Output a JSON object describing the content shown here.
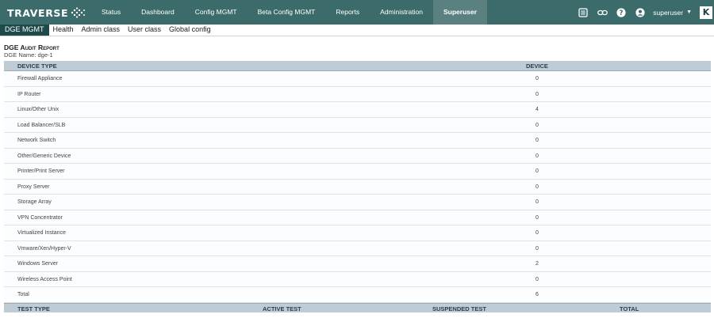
{
  "app": {
    "logo": "TRAVERSE"
  },
  "nav": {
    "items": [
      {
        "label": "Status"
      },
      {
        "label": "Dashboard"
      },
      {
        "label": "Config MGMT"
      },
      {
        "label": "Beta Config MGMT"
      },
      {
        "label": "Reports"
      },
      {
        "label": "Administration"
      },
      {
        "label": "Superuser",
        "active": true
      }
    ],
    "user": "superuser",
    "icons": [
      "list-icon",
      "link-icon",
      "help-icon",
      "user-icon",
      "brand-icon"
    ],
    "brand_letter": "K"
  },
  "subtabs": [
    {
      "label": "DGE MGMT",
      "active": true
    },
    {
      "label": "Health"
    },
    {
      "label": "Admin class"
    },
    {
      "label": "User class"
    },
    {
      "label": "Global config"
    }
  ],
  "report": {
    "title": "DGE Audit Report",
    "subtitle": "DGE Name: dge-1",
    "columns": [
      "DEVICE TYPE",
      "DEVICE"
    ],
    "rows": [
      {
        "type": "Firewall Appliance",
        "count": "0"
      },
      {
        "type": "IP Router",
        "count": "0"
      },
      {
        "type": "Linux/Other Unix",
        "count": "4"
      },
      {
        "type": "Load Balancer/SLB",
        "count": "0"
      },
      {
        "type": "Network Switch",
        "count": "0"
      },
      {
        "type": "Other/Generic Device",
        "count": "0"
      },
      {
        "type": "Printer/Print Server",
        "count": "0"
      },
      {
        "type": "Proxy Server",
        "count": "0"
      },
      {
        "type": "Storage Array",
        "count": "0"
      },
      {
        "type": "VPN Concentrator",
        "count": "0"
      },
      {
        "type": "Virtualized Instance",
        "count": "0"
      },
      {
        "type": "Vmware/Xen/Hyper-V",
        "count": "0"
      },
      {
        "type": "Windows Server",
        "count": "2"
      },
      {
        "type": "Wireless Access Point",
        "count": "0"
      },
      {
        "type": "Total",
        "count": "6"
      }
    ],
    "test_columns": [
      "TEST TYPE",
      "ACTIVE TEST",
      "SUSPENDED TEST",
      "TOTAL"
    ]
  },
  "colors": {
    "topbar": "#3b6b6b",
    "active_nav": "#5a8080",
    "active_subtab": "#1f4a4a",
    "table_header": "#bfcbd5"
  }
}
